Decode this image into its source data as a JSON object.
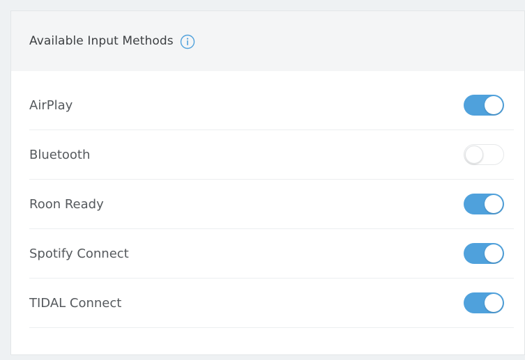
{
  "panel": {
    "title": "Available Input Methods",
    "info_icon": "info-circle-icon",
    "accent_color": "#4fa1dc"
  },
  "input_methods": [
    {
      "label": "AirPlay",
      "enabled": true
    },
    {
      "label": "Bluetooth",
      "enabled": false
    },
    {
      "label": "Roon Ready",
      "enabled": true
    },
    {
      "label": "Spotify Connect",
      "enabled": true
    },
    {
      "label": "TIDAL Connect",
      "enabled": true
    }
  ]
}
